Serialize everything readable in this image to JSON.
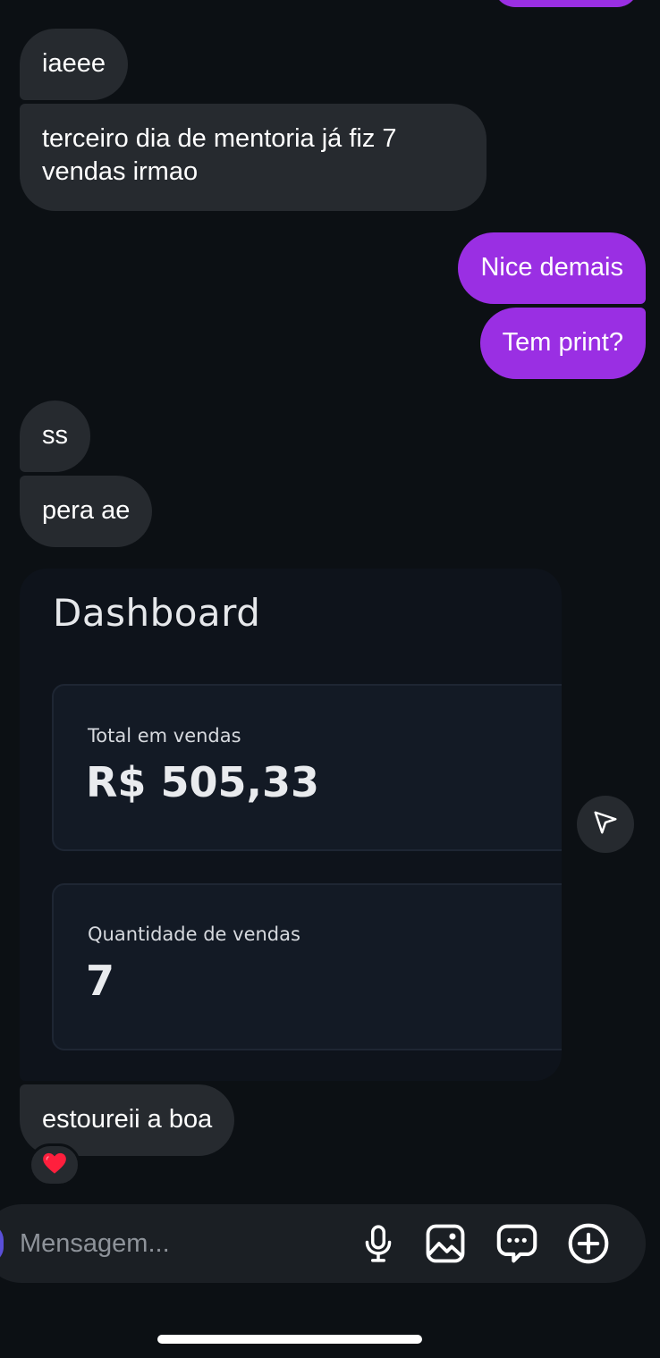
{
  "messages": {
    "m1": "iaeee",
    "m2": "terceiro dia de mentoria já fiz 7 vendas irmao",
    "m3": "Nice demais",
    "m4": "Tem print?",
    "m5": "ss",
    "m6": "pera ae",
    "m7": "estoureii a boa"
  },
  "image_message": {
    "title": "Dashboard",
    "cards": [
      {
        "label": "Total em vendas",
        "value": "R$ 505,33"
      },
      {
        "label": "Quantidade de vendas",
        "value": "7"
      }
    ]
  },
  "reaction": {
    "emoji": "heart-icon"
  },
  "composer": {
    "placeholder": "Mensagem..."
  },
  "colors": {
    "background": "#0c1014",
    "incoming_bubble": "#262a2f",
    "outgoing_bubble": "#9a2fe3",
    "composer": "#1b1f24"
  }
}
